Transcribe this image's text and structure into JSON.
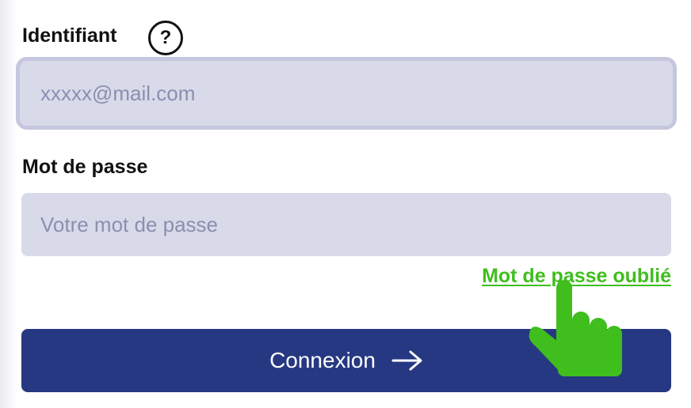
{
  "login_form": {
    "username_label": "Identifiant",
    "help_icon": "question-mark-circle-icon",
    "help_glyph": "?",
    "username_placeholder": "xxxxx@mail.com",
    "password_label": "Mot de passe",
    "password_placeholder": "Votre mot de passe",
    "forgot_password_link": "Mot de passe oublié",
    "submit_label": "Connexion",
    "submit_icon": "arrow-right-icon"
  },
  "overlay": {
    "cursor_icon": "hand-pointer-icon"
  },
  "colors": {
    "input_background": "#d9dae9",
    "focus_border": "#c4c7dd",
    "link": "#3fbe1e",
    "button_background": "#273882",
    "cursor": "#3fbe1e"
  }
}
